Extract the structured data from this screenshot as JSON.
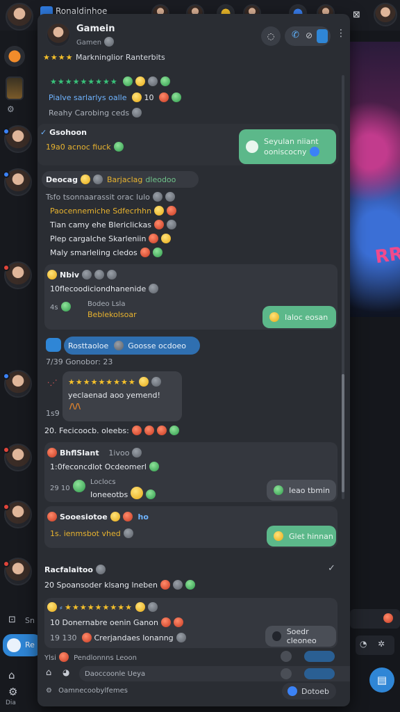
{
  "app": {
    "title": "Ronaldinhoe"
  },
  "header": {
    "name": "Gamein",
    "subtitle": "Gamen",
    "rating_text": "Markninglior Ranterbits"
  },
  "messages": {
    "m1_text": "Pialve sarlarlys oalle",
    "m1_num": "10",
    "m1_meta": "Reahy Carobing ceds",
    "m2_name": "Gsohoon",
    "m2_meta": "19a0 acnoc fiuck",
    "m2_bubble_line1": "Seyulan niiant",
    "m2_bubble_line2": "ooniscocny",
    "m3_name": "Deocag",
    "m3_tag": "Barjaclag",
    "m3_tag2": "dleodoo",
    "m3_line0": "Tsfo tsonnaarassit orac lulo",
    "m3_line1": "Paocennemiche Sdfecrhhn",
    "m3_line2": "Tian camy ehe Blericlickas",
    "m3_line3": "Plep cargalche Skarleniin",
    "m3_line4": "Maly smarleling cledos",
    "c1_name": "Nbiv",
    "c1_line": "10flecoodiciondhanenide",
    "c1_sub1": "Bodeo Lsla",
    "c1_sub2": "Beblekolsoar",
    "c1_bubble": "Ialoc eosan",
    "pill_left": "Rosttaoloe",
    "pill_right": "Goosse ocdoeo",
    "time_row": "7/39 Gonobor: 23",
    "ann_text": "yeclaenad aoo yemend!",
    "ann_time": "1s9",
    "ann_below": "20. Fecicoocb. oleebs:",
    "c2_name": "BhflSlant",
    "c2_meta": "1ivoo",
    "c2_line": "1:0feconcdlot Ocdeomerl",
    "c2_n1": "29",
    "c2_n2": "10",
    "c2_sub1": "Loclocs",
    "c2_sub2": "Ioneeotbs",
    "c2_bubble": "Ieao tbmin",
    "c3_name": "Sooesiotoe",
    "c3_meta": "ho",
    "c3_line": "1s. ienmsbot vhed",
    "c3_bubble": "Glet hinnan",
    "m4_name": "Racfalaitoo",
    "m4_line": "20 Spoansoder klsang lneben",
    "c4_line1": "10 Donernabre oenin Ganon",
    "c4_n1": "19",
    "c4_n2": "130",
    "c4_line2": "Crerjandaes lonanng",
    "c4_bubble": "Soedr cleoneo"
  },
  "compose": {
    "row1": "Pendlonnns Leoon",
    "row2": "Daoccoonle Ueya",
    "row3": "Oamnecoobylfemes",
    "row3_pill": "Dotoeb"
  },
  "sidebar": {
    "search_label": "Sn",
    "active_label": "Re",
    "bottom_label": "Dia"
  },
  "art": {
    "neon": "RRTU"
  },
  "colors": {
    "accent": "#2f86d6",
    "bubble_green": "#5cb88a",
    "panel": "#2a2d33",
    "star": "#f5c02b"
  }
}
